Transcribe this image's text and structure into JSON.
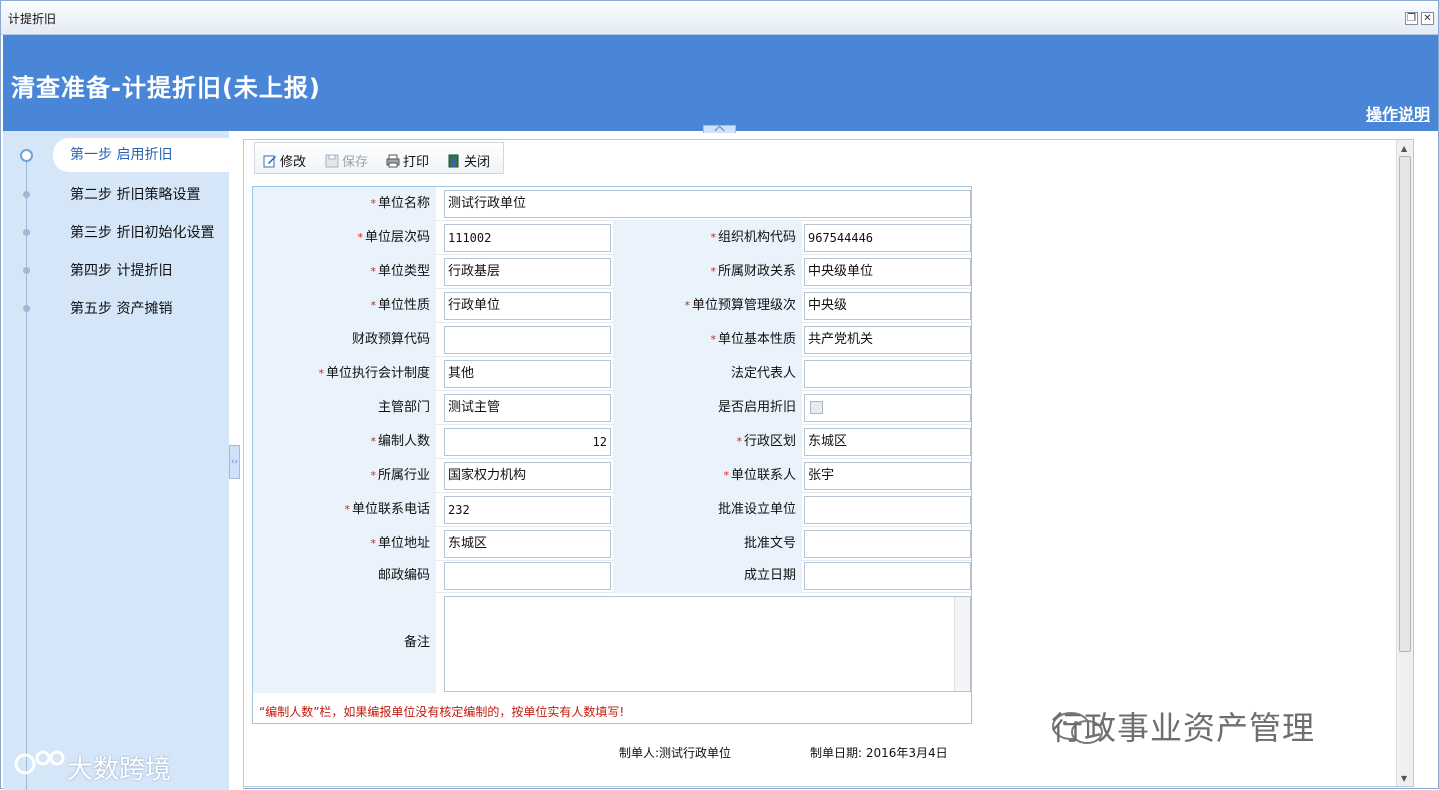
{
  "window": {
    "title": "计提折旧"
  },
  "header": {
    "title": "清查准备-计提折旧(未上报)",
    "help": "操作说明"
  },
  "steps": [
    {
      "label": "第一步 启用折旧"
    },
    {
      "label": "第二步 折旧策略设置"
    },
    {
      "label": "第三步 折旧初始化设置"
    },
    {
      "label": "第四步 计提折旧"
    },
    {
      "label": "第五步 资产摊销"
    }
  ],
  "toolbar": {
    "edit": "修改",
    "save": "保存",
    "print": "打印",
    "close": "关闭"
  },
  "form": {
    "unit_name": {
      "label": "单位名称",
      "value": "测试行政单位"
    },
    "unit_level_code": {
      "label": "单位层次码",
      "value": "111002"
    },
    "org_code": {
      "label": "组织机构代码",
      "value": "967544446"
    },
    "unit_type": {
      "label": "单位类型",
      "value": "行政基层"
    },
    "fiscal_relation": {
      "label": "所属财政关系",
      "value": "中央级单位"
    },
    "unit_nature": {
      "label": "单位性质",
      "value": "行政单位"
    },
    "budget_level": {
      "label": "单位预算管理级次",
      "value": "中央级"
    },
    "fiscal_budget_code": {
      "label": "财政预算代码",
      "value": ""
    },
    "basic_nature": {
      "label": "单位基本性质",
      "value": "共产党机关"
    },
    "accounting_system": {
      "label": "单位执行会计制度",
      "value": "其他"
    },
    "legal_rep": {
      "label": "法定代表人",
      "value": ""
    },
    "supervisor": {
      "label": "主管部门",
      "value": "测试主管"
    },
    "enable_depreciation": {
      "label": "是否启用折旧"
    },
    "staff_count": {
      "label": "编制人数",
      "value": "12"
    },
    "district": {
      "label": "行政区划",
      "value": "东城区"
    },
    "industry": {
      "label": "所属行业",
      "value": "国家权力机构"
    },
    "contact": {
      "label": "单位联系人",
      "value": "张宇"
    },
    "phone": {
      "label": "单位联系电话",
      "value": "232"
    },
    "approve_unit": {
      "label": "批准设立单位",
      "value": ""
    },
    "address": {
      "label": "单位地址",
      "value": "东城区"
    },
    "approve_doc": {
      "label": "批准文号",
      "value": ""
    },
    "postcode": {
      "label": "邮政编码",
      "value": ""
    },
    "found_date": {
      "label": "成立日期",
      "value": ""
    },
    "remark": {
      "label": "备注",
      "value": ""
    }
  },
  "note": "“编制人数”栏，如果编报单位没有核定编制的，按单位实有人数填写!",
  "footer": {
    "maker": "制单人:测试行政单位",
    "date": "制单日期: 2016年3月4日"
  },
  "watermark": {
    "right": "行政事业资产管理",
    "left": "大数跨境"
  },
  "colors": {
    "header": "#4a86d8",
    "sidebar": "#d4e6f8",
    "required": "#d9230f"
  }
}
